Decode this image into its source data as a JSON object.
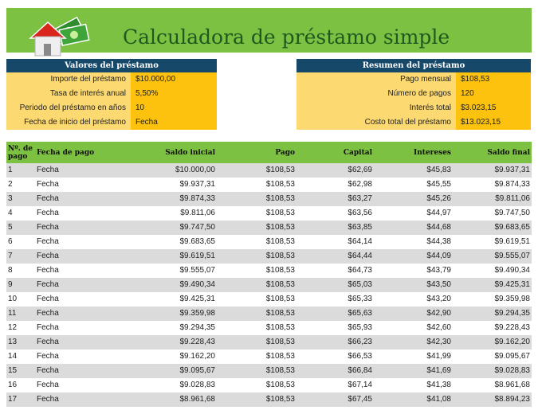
{
  "title": "Calculadora de préstamo simple",
  "loan_values": {
    "header": "Valores del préstamo",
    "rows": [
      {
        "label": "Importe del préstamo",
        "value": "$10.000,00"
      },
      {
        "label": "Tasa de interés anual",
        "value": "5,50%"
      },
      {
        "label": "Periodo del préstamo en años",
        "value": "10"
      },
      {
        "label": "Fecha de inicio del préstamo",
        "value": "Fecha"
      }
    ]
  },
  "loan_summary": {
    "header": "Resumen del préstamo",
    "rows": [
      {
        "label": "Pago mensual",
        "value": "$108,53"
      },
      {
        "label": "Número de pagos",
        "value": "120"
      },
      {
        "label": "Interés total",
        "value": "$3.023,15"
      },
      {
        "label": "Costo total del préstamo",
        "value": "$13.023,15"
      }
    ]
  },
  "schedule": {
    "columns": [
      "Nº. de pago",
      "Fecha de pago",
      "Saldo inicial",
      "Pago",
      "Capital",
      "Intereses",
      "Saldo final"
    ],
    "rows": [
      [
        "1",
        "Fecha",
        "$10.000,00",
        "$108,53",
        "$62,69",
        "$45,83",
        "$9.937,31"
      ],
      [
        "2",
        "Fecha",
        "$9.937,31",
        "$108,53",
        "$62,98",
        "$45,55",
        "$9.874,33"
      ],
      [
        "3",
        "Fecha",
        "$9.874,33",
        "$108,53",
        "$63,27",
        "$45,26",
        "$9.811,06"
      ],
      [
        "4",
        "Fecha",
        "$9.811,06",
        "$108,53",
        "$63,56",
        "$44,97",
        "$9.747,50"
      ],
      [
        "5",
        "Fecha",
        "$9.747,50",
        "$108,53",
        "$63,85",
        "$44,68",
        "$9.683,65"
      ],
      [
        "6",
        "Fecha",
        "$9.683,65",
        "$108,53",
        "$64,14",
        "$44,38",
        "$9.619,51"
      ],
      [
        "7",
        "Fecha",
        "$9.619,51",
        "$108,53",
        "$64,44",
        "$44,09",
        "$9.555,07"
      ],
      [
        "8",
        "Fecha",
        "$9.555,07",
        "$108,53",
        "$64,73",
        "$43,79",
        "$9.490,34"
      ],
      [
        "9",
        "Fecha",
        "$9.490,34",
        "$108,53",
        "$65,03",
        "$43,50",
        "$9.425,31"
      ],
      [
        "10",
        "Fecha",
        "$9.425,31",
        "$108,53",
        "$65,33",
        "$43,20",
        "$9.359,98"
      ],
      [
        "11",
        "Fecha",
        "$9.359,98",
        "$108,53",
        "$65,63",
        "$42,90",
        "$9.294,35"
      ],
      [
        "12",
        "Fecha",
        "$9.294,35",
        "$108,53",
        "$65,93",
        "$42,60",
        "$9.228,43"
      ],
      [
        "13",
        "Fecha",
        "$9.228,43",
        "$108,53",
        "$66,23",
        "$42,30",
        "$9.162,20"
      ],
      [
        "14",
        "Fecha",
        "$9.162,20",
        "$108,53",
        "$66,53",
        "$41,99",
        "$9.095,67"
      ],
      [
        "15",
        "Fecha",
        "$9.095,67",
        "$108,53",
        "$66,84",
        "$41,69",
        "$9.028,83"
      ],
      [
        "16",
        "Fecha",
        "$9.028,83",
        "$108,53",
        "$67,14",
        "$41,38",
        "$8.961,68"
      ],
      [
        "17",
        "Fecha",
        "$8.961,68",
        "$108,53",
        "$67,45",
        "$41,08",
        "$8.894,23"
      ]
    ]
  },
  "icons": {
    "logo": "house-with-money-icon"
  },
  "colors": {
    "banner": "#7dc142",
    "title": "#1e5a20",
    "panel_header": "#16486a",
    "label_fill": "#fdd971",
    "value_fill": "#fdc20e",
    "row_alt": "#dbdbdb"
  }
}
